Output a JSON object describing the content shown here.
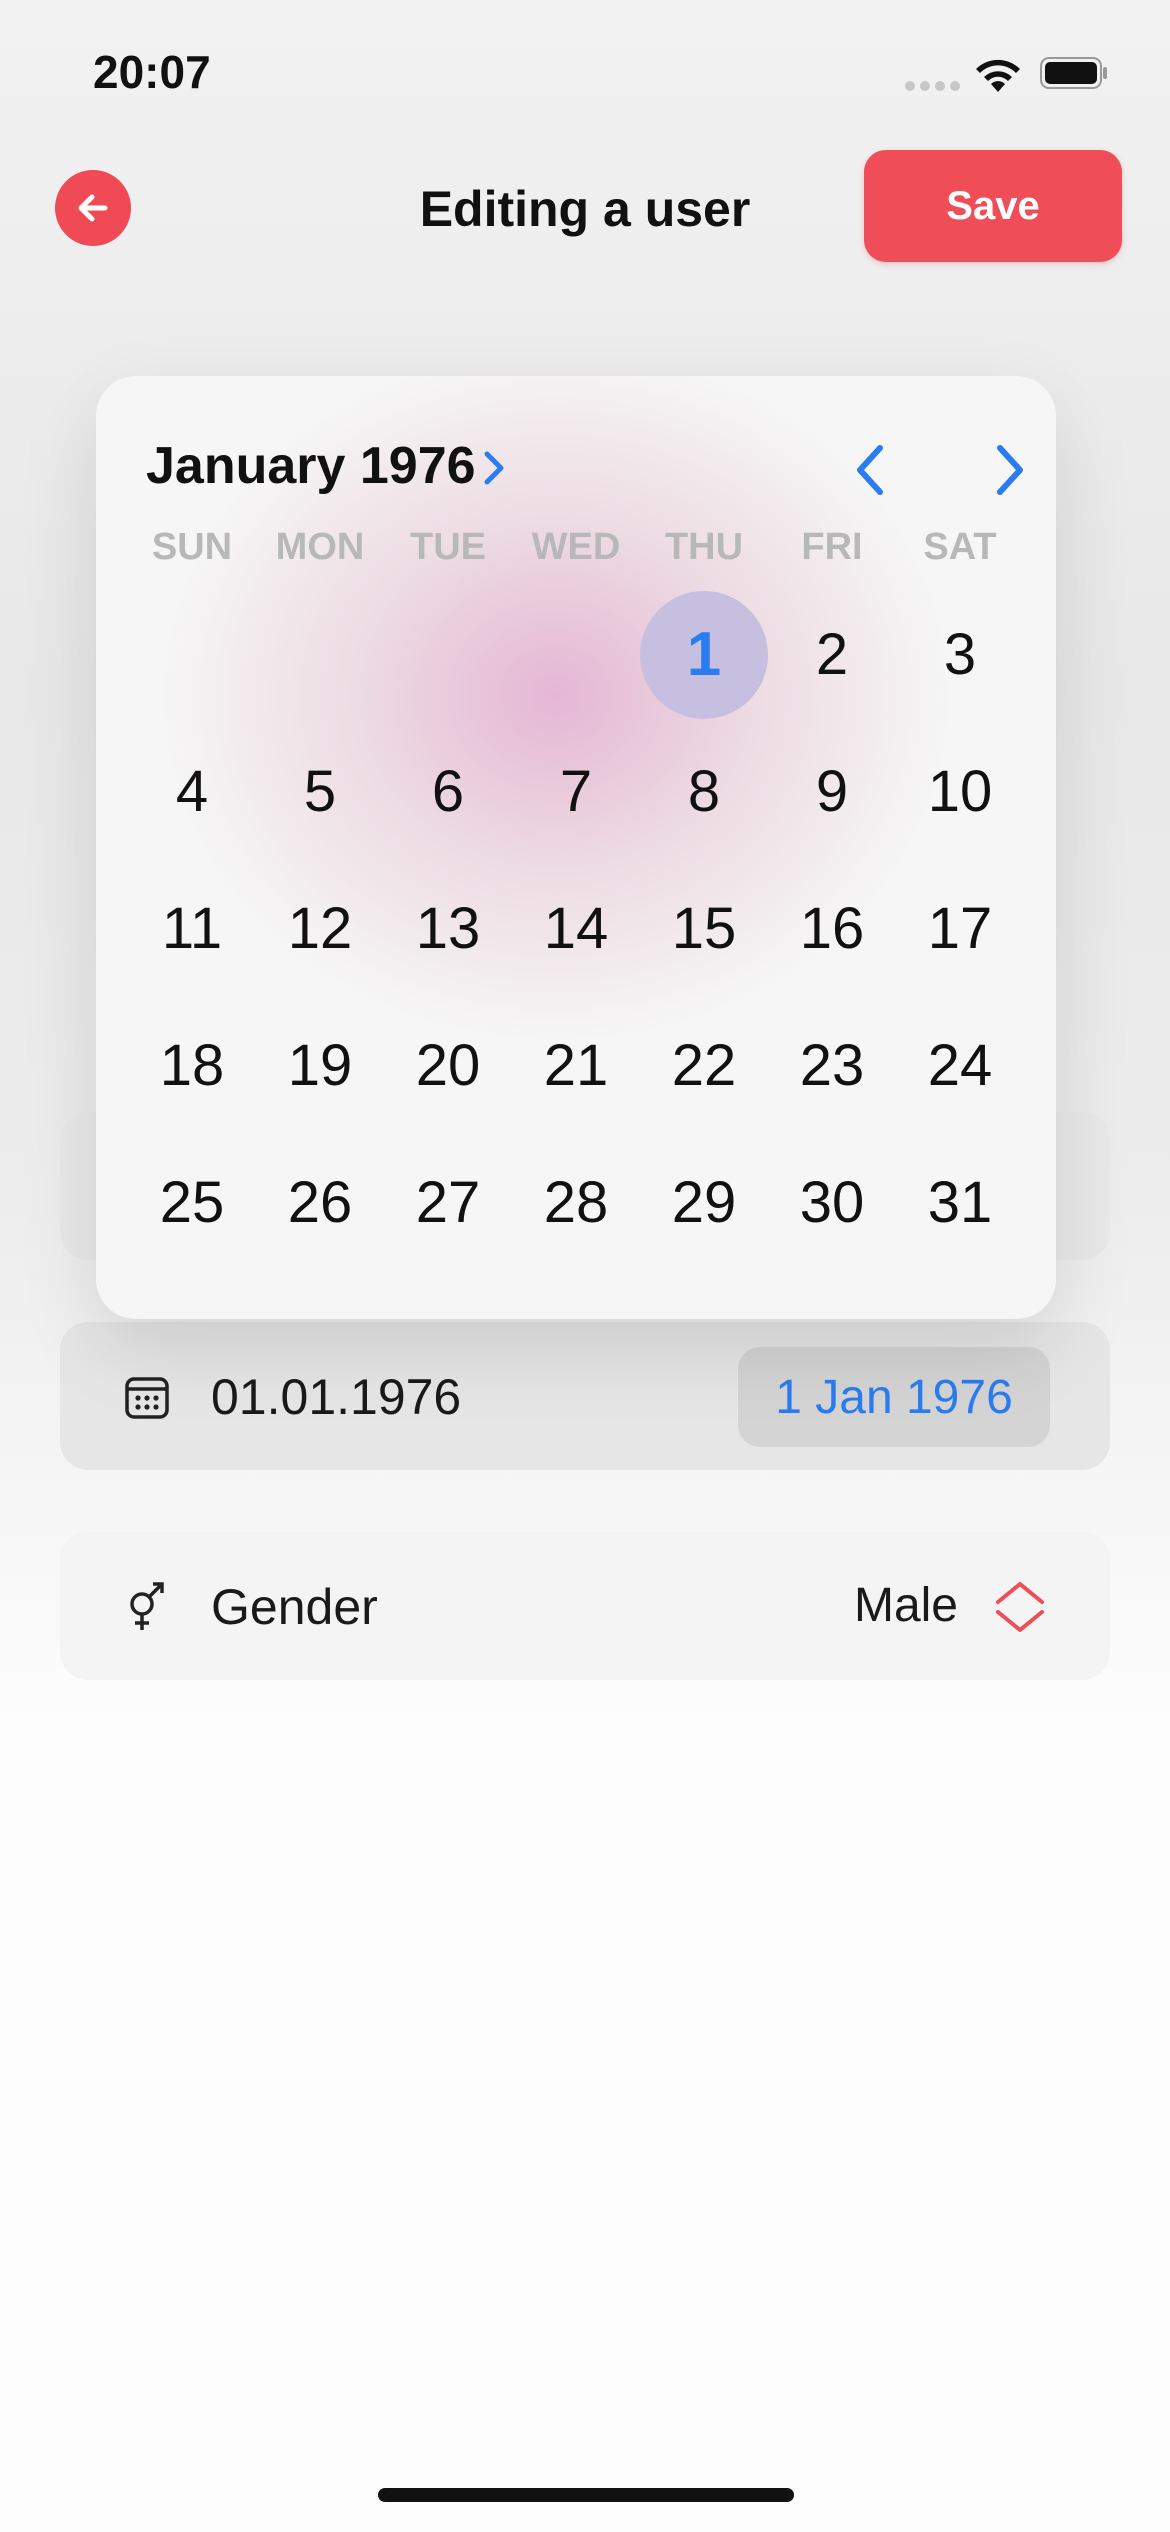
{
  "status_bar": {
    "time": "20:07"
  },
  "nav": {
    "title": "Editing a user",
    "save_label": "Save"
  },
  "calendar": {
    "month_label": "January 1976",
    "weekdays": [
      "SUN",
      "MON",
      "TUE",
      "WED",
      "THU",
      "FRI",
      "SAT"
    ],
    "leading_blank_days": 4,
    "days": [
      "1",
      "2",
      "3",
      "4",
      "5",
      "6",
      "7",
      "8",
      "9",
      "10",
      "11",
      "12",
      "13",
      "14",
      "15",
      "16",
      "17",
      "18",
      "19",
      "20",
      "21",
      "22",
      "23",
      "24",
      "25",
      "26",
      "27",
      "28",
      "29",
      "30",
      "31"
    ],
    "selected_day": "1"
  },
  "birthdate_row": {
    "value": "01.01.1976",
    "chip": "1 Jan 1976",
    "icon": "calendar-icon"
  },
  "gender_row": {
    "label": "Gender",
    "value": "Male",
    "icon": "gender-icon"
  },
  "colors": {
    "accent": "#ef4d58",
    "link_blue": "#2a7df0",
    "selected_day_bg": "#c6bfe0"
  }
}
